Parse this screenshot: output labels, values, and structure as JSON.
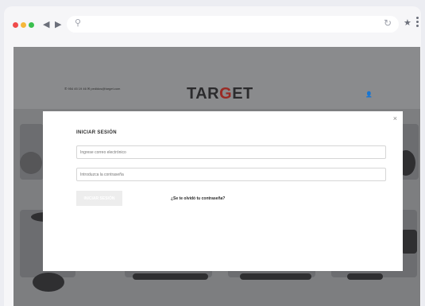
{
  "browser": {
    "back_icon": "◀",
    "forward_icon": "▶",
    "search_icon": "⚲",
    "reload_icon": "↻",
    "star_icon": "★"
  },
  "site": {
    "contact_text": "✆ 954 45 19 46   ✉ pedidos@target.com",
    "logo_prefix": "TAR",
    "logo_highlight": "G",
    "logo_suffix": "ET",
    "user_icon": "👤"
  },
  "modal": {
    "close_icon": "×",
    "title": "INICIAR SESIÓN",
    "email_placeholder": "Ingrese correo electrónico",
    "password_placeholder": "Introduzca la contraseña",
    "login_button": "INICIAR SESIÓN",
    "forgot_link": "¿Se te olvidó tu contraseña?"
  }
}
